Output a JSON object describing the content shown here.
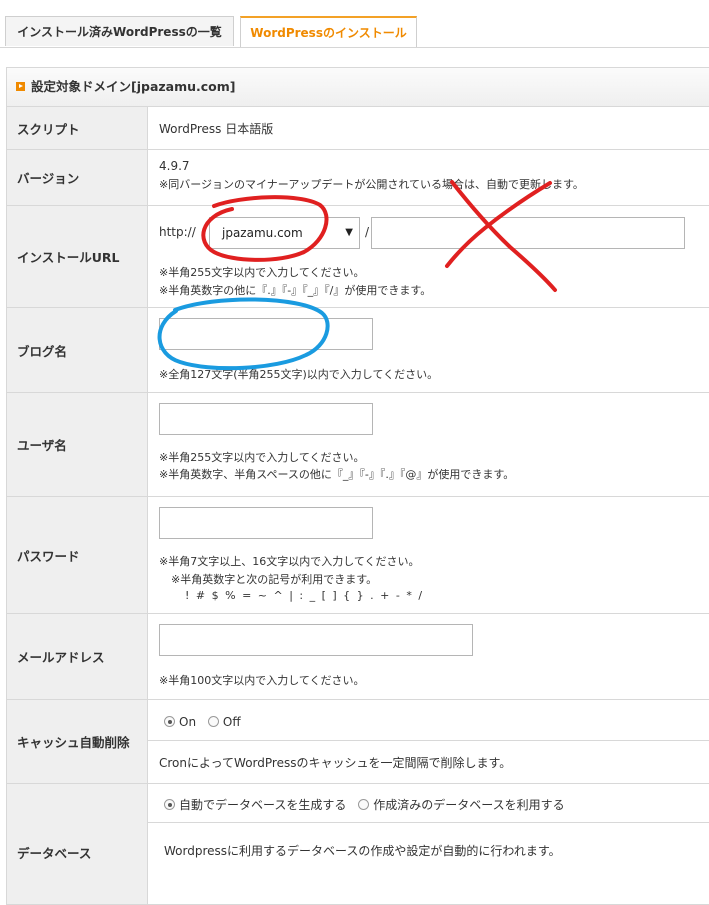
{
  "tabs": [
    {
      "label": "インストール済みWordPressの一覧"
    },
    {
      "label": "WordPressのインストール"
    }
  ],
  "panel": {
    "title": "設定対象ドメイン[jpazamu.com]"
  },
  "rows": {
    "script": {
      "label": "スクリプト",
      "value": "WordPress 日本語版"
    },
    "version": {
      "label": "バージョン",
      "value": "4.9.7",
      "note": "※同バージョンのマイナーアップデートが公開されている場合は、自動で更新します。"
    },
    "url": {
      "label": "インストールURL",
      "protocol": "http://",
      "domain": "jpazamu.com",
      "slash": "/",
      "path_value": "",
      "note1": "※半角255文字以内で入力してください。",
      "note2": "※半角英数字の他に『.』『-』『_』『/』が使用できます。"
    },
    "blog": {
      "label": "ブログ名",
      "value": "",
      "note": "※全角127文字(半角255文字)以内で入力してください。"
    },
    "user": {
      "label": "ユーザ名",
      "value": "",
      "note1": "※半角255文字以内で入力してください。",
      "note2": "※半角英数字、半角スペースの他に『_』『-』『.』『@』が使用できます。"
    },
    "password": {
      "label": "パスワード",
      "value": "",
      "note1": "※半角7文字以上、16文字以内で入力してください。",
      "note2": "※半角英数字と次の記号が利用できます。",
      "symbols": "! # $ % = ~ ^ | : _ [ ] { } . + - * /"
    },
    "email": {
      "label": "メールアドレス",
      "value": "",
      "note": "※半角100文字以内で入力してください。"
    },
    "cache": {
      "label": "キャッシュ自動削除",
      "on": "On",
      "off": "Off",
      "selected": "On",
      "note": "CronによってWordPressのキャッシュを一定間隔で削除します。"
    },
    "database": {
      "label": "データベース",
      "option1": "自動でデータベースを生成する",
      "option2": "作成済みのデータベースを利用する",
      "selected": "option1",
      "note": "Wordpressに利用するデータベースの作成や設定が自動的に行われます。"
    }
  },
  "annotations": [
    {
      "kind": "circle",
      "color": "#e02020",
      "around": "domain-select"
    },
    {
      "kind": "cross",
      "color": "#e02020",
      "over": "path-input"
    },
    {
      "kind": "circle",
      "color": "#1a9be0",
      "around": "blog-name-input"
    }
  ]
}
